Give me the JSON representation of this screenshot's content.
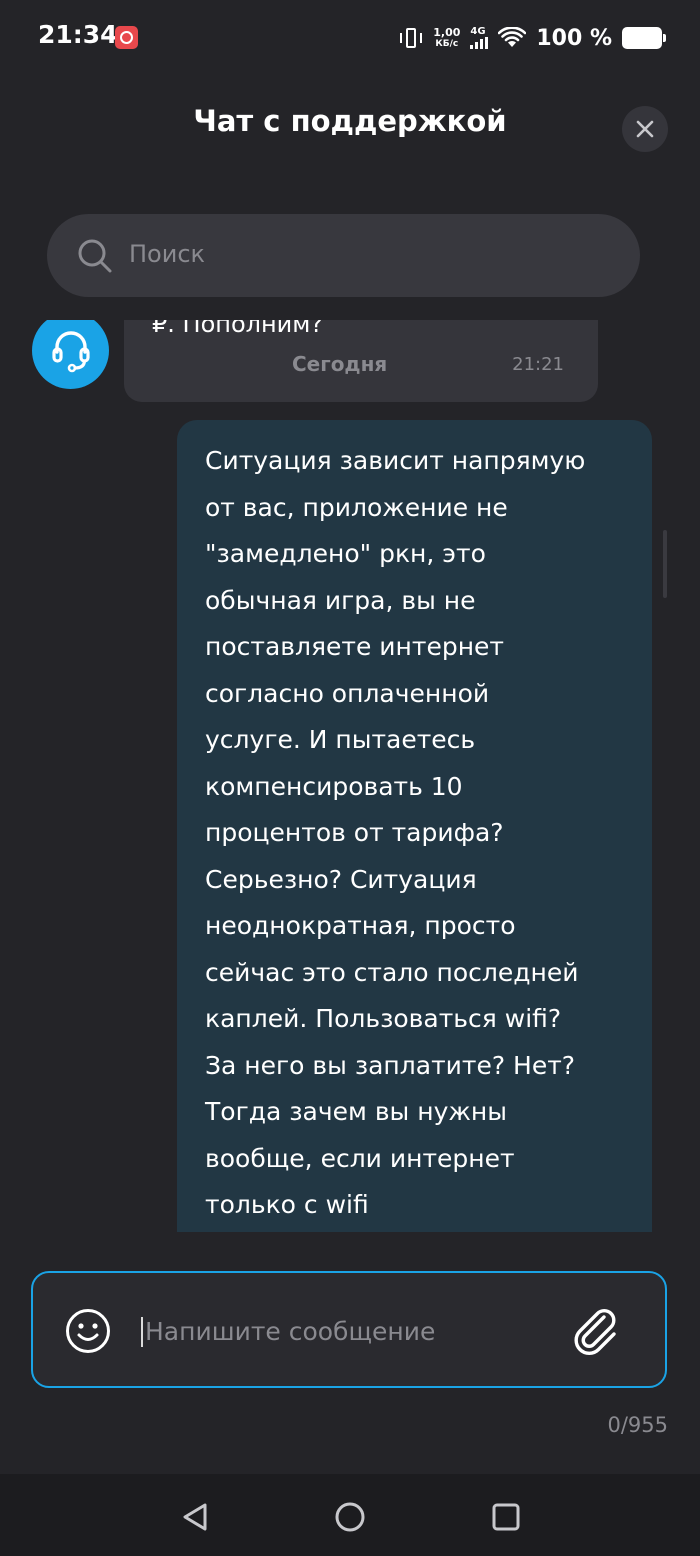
{
  "status_bar": {
    "time": "21:34",
    "net_speed_value": "1,00",
    "net_speed_unit": "КБ/с",
    "network_type": "4G",
    "battery": "100 %"
  },
  "header": {
    "title": "Чат с поддержкой",
    "close_icon": "close-icon"
  },
  "search": {
    "placeholder": "Поиск"
  },
  "messages": [
    {
      "sender": "support",
      "text": "₽. Пополним?",
      "date_label": "Сегодня",
      "time": "21:21"
    },
    {
      "sender": "user",
      "text": "Ситуация зависит напрямую\nот вас, приложение не\n\"замедлено\" ркн, это\nобычная игра, вы не\nпоставляете интернет\nсогласно оплаченной\nуслуге. И пытаетесь\nкомпенсировать 10\nпроцентов от тарифа?\nСерьезно? Ситуация\nнеоднократная, просто\nсейчас это стало последней\nкаплей. Пользоваться wifi?\nЗа него вы заплатите? Нет?\nТогда зачем вы нужны\nвообще, если интернет\nтолько с wifi"
    }
  ],
  "composer": {
    "placeholder": "Напишите сообщение",
    "counter": "0/955"
  },
  "colors": {
    "background": "#242428",
    "accent": "#1aa3e6",
    "user_bubble": "#223744",
    "support_bubble": "#35353b"
  }
}
